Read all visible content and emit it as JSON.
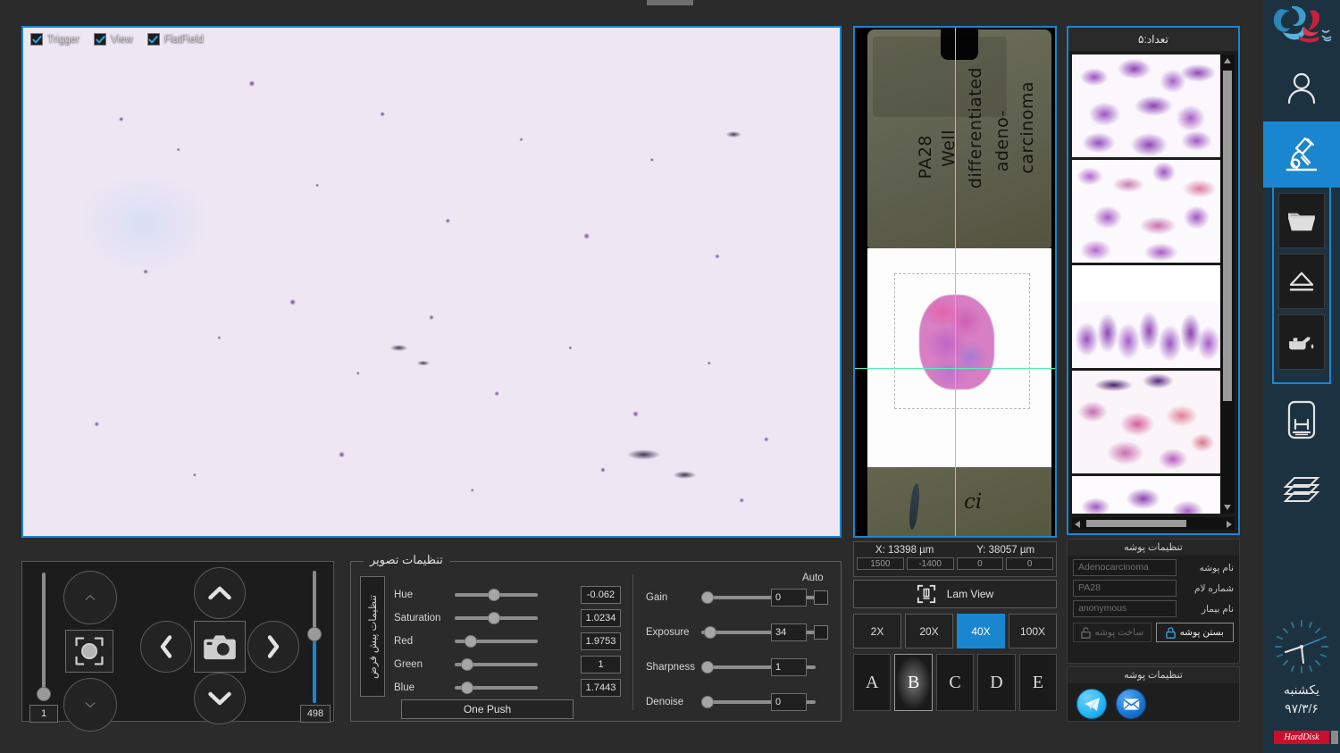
{
  "live_view": {
    "checkboxes": [
      {
        "label": "Trigger",
        "checked": true
      },
      {
        "label": "View",
        "checked": true
      },
      {
        "label": "FlatField",
        "checked": true
      }
    ]
  },
  "nav_panel": {
    "left_slider_value": "1",
    "right_slider_value": "498",
    "buttons": {
      "focus_up": "focus-coarse-up",
      "focus_down": "focus-coarse-down",
      "aperture": "aperture",
      "camera": "capture",
      "up": "stage-up",
      "down": "stage-down",
      "left": "stage-left",
      "right": "stage-right"
    }
  },
  "image_settings": {
    "legend": "تنظیمات تصویر",
    "vertical_label": "تنظیمات پیش فرض",
    "auto_label": "Auto",
    "one_push_label": "One Push",
    "color_sliders": [
      {
        "name": "Hue",
        "value": "-0.062",
        "pos": 48
      },
      {
        "name": "Saturation",
        "value": "1.0234",
        "pos": 46
      },
      {
        "name": "Red",
        "value": "1.9753",
        "pos": 19
      },
      {
        "name": "Green",
        "value": "1",
        "pos": 16
      },
      {
        "name": "Blue",
        "value": "1.7443",
        "pos": 16
      }
    ],
    "camera_sliders": [
      {
        "name": "Gain",
        "value": "0",
        "pos": 2,
        "auto": false,
        "has_auto": true
      },
      {
        "name": "Exposure",
        "value": "34",
        "pos": 4,
        "auto": false,
        "has_auto": true
      },
      {
        "name": "Sharpness",
        "value": "1",
        "pos": 2,
        "has_auto": false
      },
      {
        "name": "Denoise",
        "value": "0",
        "pos": 2,
        "has_auto": false
      }
    ]
  },
  "macro_view": {
    "slide_label_lines": [
      "PA28",
      "Well",
      "differentiated",
      "adeno-",
      "carcinoma"
    ],
    "bottom_mark": "ci",
    "crosshair_color": "#52f0b4"
  },
  "stage": {
    "x_label": "X:  13398 µm",
    "y_label": "Y:  38057 µm",
    "fields": [
      "1500",
      "-1400",
      "0",
      "0"
    ],
    "lam_view_label": "Lam View",
    "magnifications": [
      {
        "label": "2X",
        "active": false
      },
      {
        "label": "20X",
        "active": false
      },
      {
        "label": "40X",
        "active": true
      },
      {
        "label": "100X",
        "active": false
      }
    ],
    "slots": [
      {
        "label": "A",
        "active": false
      },
      {
        "label": "B",
        "active": true
      },
      {
        "label": "C",
        "active": false
      },
      {
        "label": "D",
        "active": false
      },
      {
        "label": "E",
        "active": false
      }
    ]
  },
  "thumbnails": {
    "header": "تعداد:۵",
    "items": [
      {
        "name": "thumbnail-1"
      },
      {
        "name": "thumbnail-2"
      },
      {
        "name": "thumbnail-3"
      },
      {
        "name": "thumbnail-4"
      },
      {
        "name": "thumbnail-5"
      }
    ]
  },
  "folder_settings": {
    "title": "تنظیمات پوشه",
    "rows": [
      {
        "label": "نام پوشه",
        "value": "Adenocarcinoma"
      },
      {
        "label": "شماره لام",
        "value": "PA28"
      },
      {
        "label": "نام بیمار",
        "value": "anonymous"
      }
    ],
    "close_folder_label": "بستن پوشه",
    "create_folder_label": "ساخت پوشه"
  },
  "share_panel": {
    "title": "تنظیمات پوشه",
    "telegram_color": "#29b6f6",
    "email_color": "#1976d2"
  },
  "rail": {
    "items": [
      {
        "name": "user-icon",
        "active": false
      },
      {
        "name": "microscope-icon",
        "active": true
      },
      {
        "name": "folder-icon",
        "active": false
      },
      {
        "name": "eject-icon",
        "active": false
      },
      {
        "name": "oil-can-icon",
        "active": false
      },
      {
        "name": "scanner-icon",
        "active": false
      },
      {
        "name": "layers-icon",
        "active": false
      }
    ],
    "clock": {
      "day": "یکشنبه",
      "date": "۹۷/۳/۶"
    },
    "storage_badge": "HardDisk"
  },
  "colors": {
    "accent_blue": "#1a86d0",
    "rail_bg": "#1d3240",
    "app_bg": "#2b2b2b",
    "badge_red": "#c8102e"
  }
}
